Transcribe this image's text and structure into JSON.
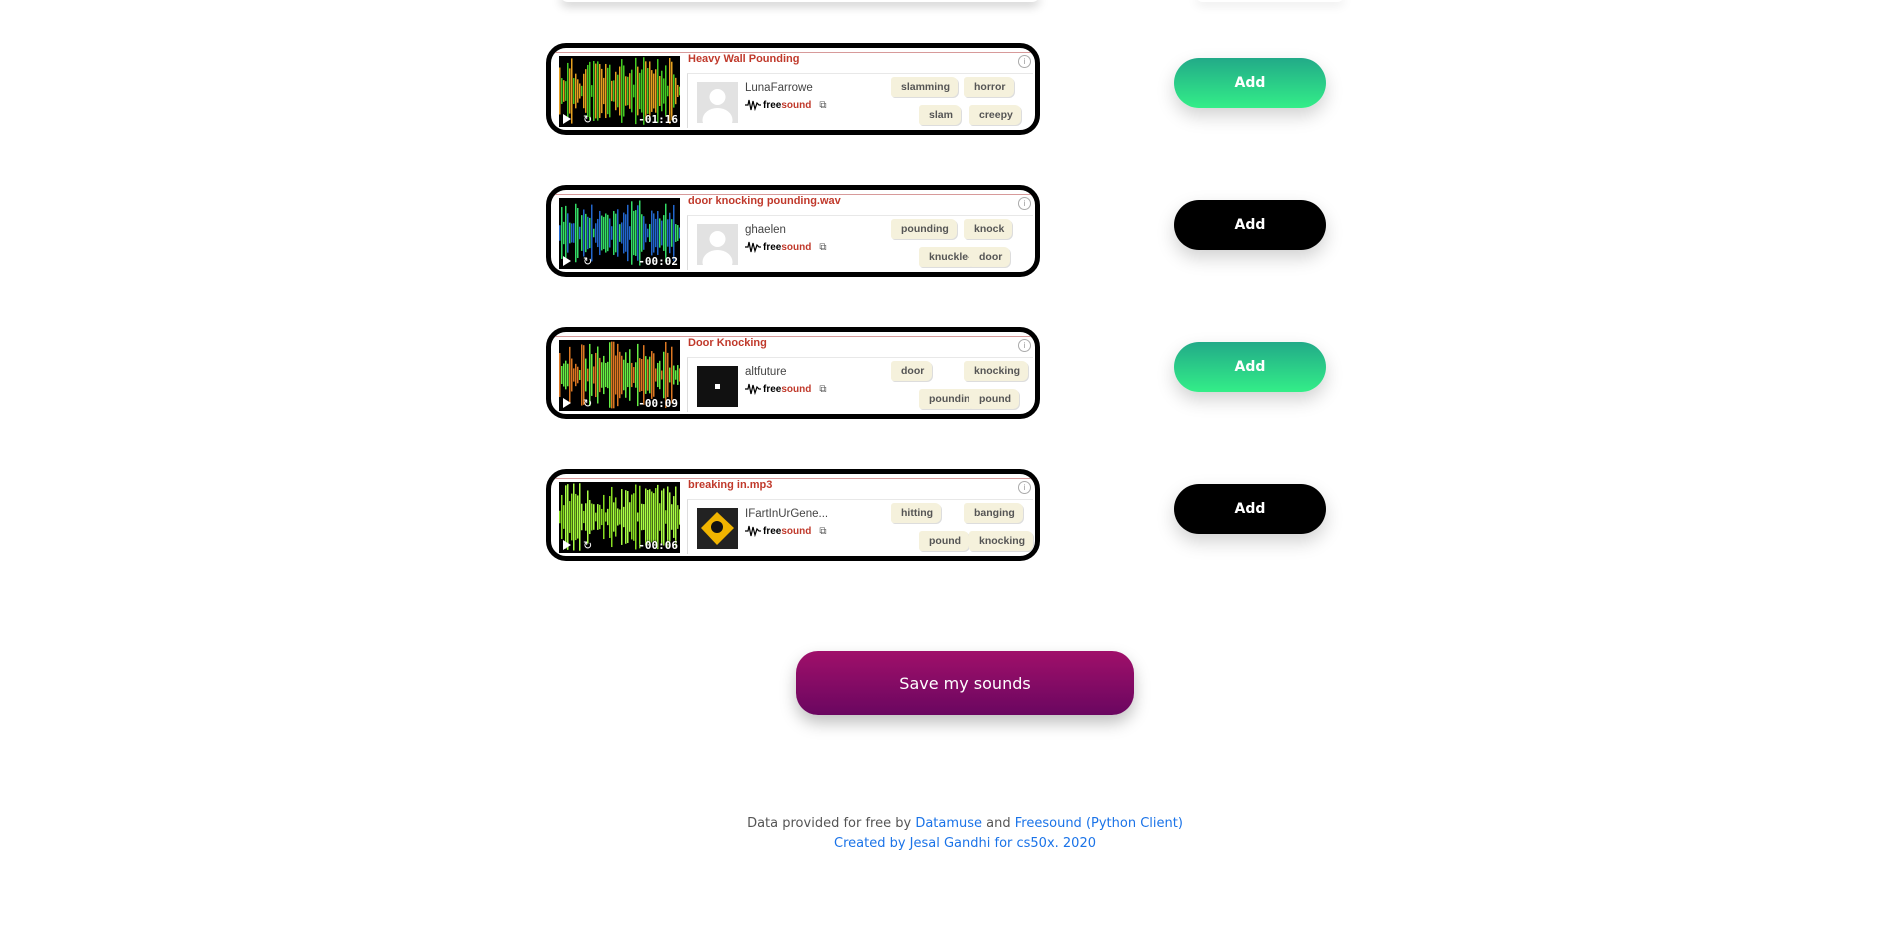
{
  "sounds": [
    {
      "title": "Heavy Wall Pounding",
      "duration": "-01:16",
      "user": "LunaFarrowe",
      "avatar": "default",
      "tags": [
        "slamming",
        "horror",
        "slam",
        "creepy"
      ],
      "add_label": "Add",
      "add_style": "green",
      "wave_colors": [
        "#e6a020",
        "#44cc22"
      ]
    },
    {
      "title": "door knocking pounding.wav",
      "duration": "-00:02",
      "user": "ghaelen",
      "avatar": "default",
      "tags": [
        "pounding",
        "knock",
        "knuckle-rap",
        "door"
      ],
      "add_label": "Add",
      "add_style": "black",
      "wave_colors": [
        "#2266cc",
        "#33dd66"
      ]
    },
    {
      "title": "Door Knocking",
      "duration": "-00:09",
      "user": "altfuture",
      "avatar": "dark",
      "tags": [
        "door",
        "knocking",
        "pounding",
        "pound"
      ],
      "add_label": "Add",
      "add_style": "green",
      "wave_colors": [
        "#dd7722",
        "#66ee44"
      ]
    },
    {
      "title": "breaking in.mp3",
      "duration": "-00:06",
      "user": "IFartInUrGene...",
      "avatar": "logo",
      "tags": [
        "hitting",
        "banging",
        "pound",
        "knocking"
      ],
      "add_label": "Add",
      "add_style": "black",
      "wave_colors": [
        "#88dd22",
        "#aaff44"
      ]
    }
  ],
  "freesound_brand": {
    "prefix": "free",
    "suffix": "sound"
  },
  "save_label": "Save my sounds",
  "footer": {
    "line1_prefix": "Data provided for free by ",
    "datamuse": "Datamuse",
    "and": " and ",
    "freesound": "Freesound (Python Client)",
    "line2": "Created by Jesal Gandhi for cs50x. 2020"
  }
}
